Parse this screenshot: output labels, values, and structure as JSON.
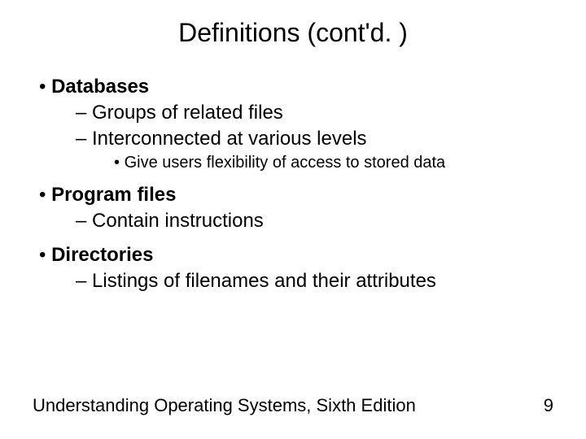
{
  "title": "Definitions (cont'd. )",
  "bullets": {
    "b1": "Databases",
    "b1a": "Groups of related files",
    "b1b": "Interconnected at various levels",
    "b1b1": "Give users flexibility of access to stored data",
    "b2": "Program files",
    "b2a": "Contain instructions",
    "b3": "Directories",
    "b3a": "Listings of filenames and their attributes"
  },
  "footer": "Understanding Operating Systems, Sixth Edition",
  "page": "9"
}
